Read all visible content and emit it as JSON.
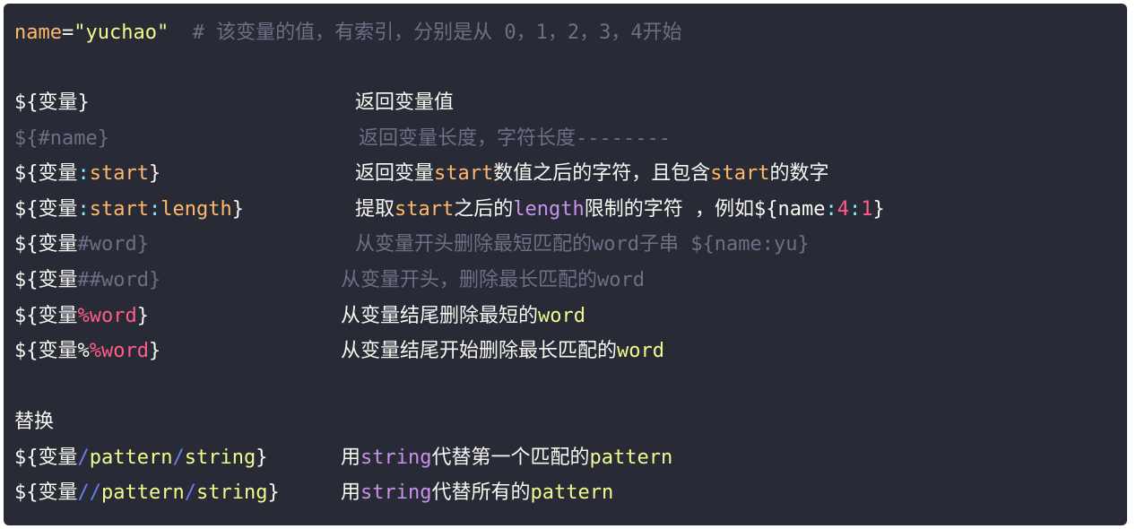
{
  "line1": {
    "var_name": "name",
    "eq": "=",
    "value": "\"yuchao\"",
    "comment": "  # 该变量的值，有索引，分别是从 0，1，2，3，4开始"
  },
  "rows": [
    {
      "parts": [
        "${",
        "变量",
        "}"
      ],
      "desc": [
        "返回变量值"
      ]
    },
    {
      "parts": [
        "${",
        "#name",
        "}"
      ],
      "desc": [
        "返回变量长度，字符长度--------"
      ]
    },
    {
      "parts": [
        "${",
        "变量",
        ":",
        "start",
        "}"
      ],
      "desc": [
        "返回变量",
        "start",
        "数值之后的字符，且包含",
        "start",
        "的数字"
      ]
    },
    {
      "parts": [
        "${",
        "变量",
        ":",
        "start",
        ":",
        "length",
        "}"
      ],
      "desc": [
        "提取",
        "start",
        "之后的",
        "length",
        "限制的字符 ，例如${",
        "name",
        ":",
        "4",
        ":",
        "1",
        "}"
      ]
    },
    {
      "parts": [
        "${",
        "变量",
        "#word",
        "}"
      ],
      "desc": [
        "从变量开头删除最短匹配的word子串 ${name:yu}"
      ]
    },
    {
      "parts": [
        "${",
        "变量",
        "##word",
        "}"
      ],
      "desc": [
        "从变量开头，删除最长匹配的word"
      ]
    },
    {
      "parts": [
        "${",
        "变量",
        "%word",
        "}"
      ],
      "desc": [
        "从变量结尾删除最短的",
        "word"
      ]
    },
    {
      "parts": [
        "${",
        "变量",
        "%",
        "%word",
        "}"
      ],
      "desc": [
        "从变量结尾开始删除最长匹配的",
        "word"
      ]
    }
  ],
  "replace_heading": "替换",
  "replace_rows": [
    {
      "parts": [
        "${",
        "变量",
        "/",
        "pattern",
        "/",
        "string",
        "}"
      ],
      "desc": [
        "用",
        "string",
        "代替第一个匹配的",
        "pattern"
      ]
    },
    {
      "parts": [
        "${",
        "变量",
        "//",
        "pattern",
        "/",
        "string",
        "}"
      ],
      "desc": [
        "用",
        "string",
        "代替所有的",
        "pattern"
      ]
    }
  ]
}
